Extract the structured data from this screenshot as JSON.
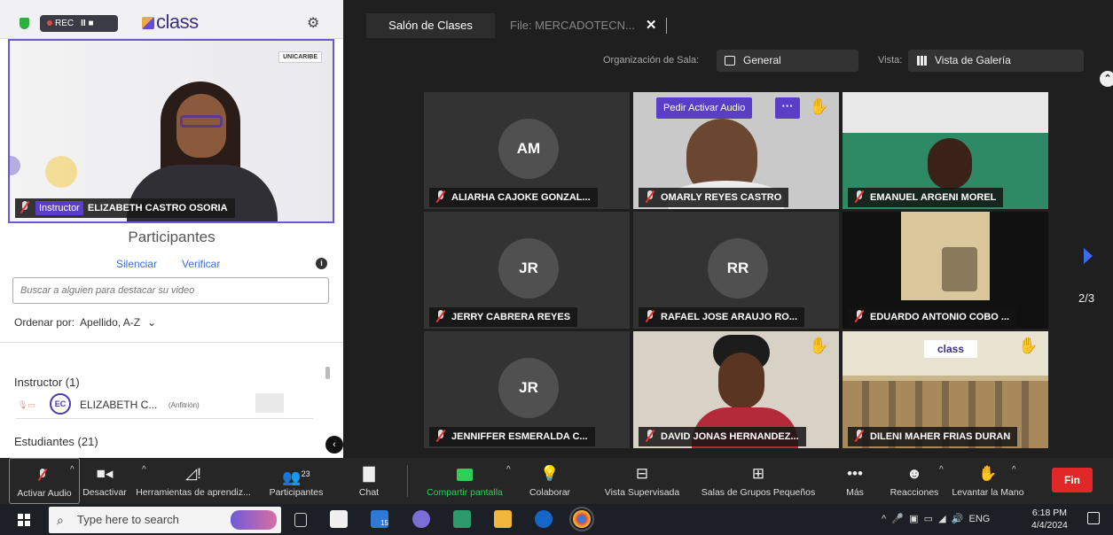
{
  "recording": {
    "label": "REC",
    "controls": "II"
  },
  "app": {
    "logo_text": "class"
  },
  "instructor_video": {
    "badge": "Instructor",
    "name": "ELIZABETH CASTRO OSORIA",
    "watermark": "UNICARIBE"
  },
  "participants_panel": {
    "title": "Participantes",
    "mute_all": "Silenciar",
    "verify": "Verificar",
    "search_placeholder": "Buscar a alguien para destacar su video",
    "sort_label": "Ordenar por:",
    "sort_value": "Apellido, A-Z",
    "instructor_section": "Instructor (1)",
    "instructor_row": {
      "initials": "EC",
      "name": "ELIZABETH C...",
      "role": "(Anfitrión)"
    },
    "students_section": "Estudiantes (21)"
  },
  "tabs": [
    {
      "label": "Salón de Clases",
      "active": true
    },
    {
      "label": "File: MERCADOTECN...",
      "active": false
    }
  ],
  "room_controls": {
    "org_label": "Organización de Sala:",
    "org_value": "General",
    "view_label": "Vista:",
    "view_value": "Vista de Galería"
  },
  "gallery": {
    "page_indicator": "2/3",
    "request_audio": "Pedir Activar Audio",
    "more": "···",
    "tiles": [
      {
        "initials": "AM",
        "name": "ALIARHA CAJOKE GONZAL..."
      },
      {
        "initials": "",
        "name": "OMARLY REYES CASTRO"
      },
      {
        "initials": "",
        "name": "EMANUEL ARGENI MOREL"
      },
      {
        "initials": "JR",
        "name": "JERRY CABRERA REYES"
      },
      {
        "initials": "RR",
        "name": "RAFAEL JOSE ARAUJO RO..."
      },
      {
        "initials": "",
        "name": "EDUARDO ANTONIO COBO ..."
      },
      {
        "initials": "JR",
        "name": "JENNIFFER ESMERALDA C..."
      },
      {
        "initials": "",
        "name": "DAVID JONAS HERNANDEZ..."
      },
      {
        "initials": "",
        "name": "DILENI MAHER FRIAS DURAN"
      }
    ],
    "slide_logo": "class"
  },
  "toolbar": {
    "audio": "Activar Audio",
    "video": "Desactivar",
    "tools": "Herramientas de aprendiz...",
    "participants": "Participantes",
    "participants_count": "23",
    "chat": "Chat",
    "share": "Compartir pantalla",
    "collab": "Colaborar",
    "supervised": "Vista Supervisada",
    "breakout": "Salas de Grupos Pequeños",
    "more": "Más",
    "reactions": "Reacciones",
    "raise_hand": "Levantar la Mano",
    "end": "Fin"
  },
  "taskbar": {
    "search_placeholder": "Type here to search",
    "language": "ENG",
    "time": "6:18 PM",
    "date": "4/4/2024",
    "mail_badge": "15"
  },
  "colors": {
    "accent": "#5b3ec8",
    "end": "#e02828",
    "share": "#2fcf57"
  }
}
